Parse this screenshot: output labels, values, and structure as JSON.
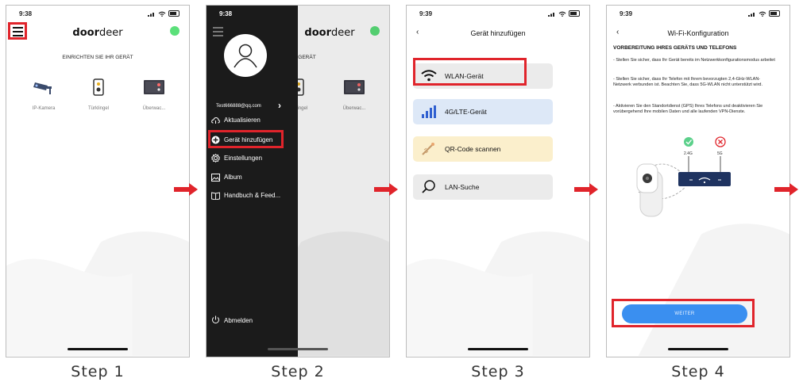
{
  "steps": [
    "Step 1",
    "Step 2",
    "Step 3",
    "Step 4"
  ],
  "colors": {
    "accent_red": "#e0242b",
    "button_blue": "#3a8ff0",
    "status_green": "#5be07a"
  },
  "phone1": {
    "time": "9:38",
    "brand_bold": "door",
    "brand_light": "deer",
    "subtitle": "EINRICHTEN SIE IHR GERÄT",
    "devices": [
      {
        "label": "IP-Kamera",
        "icon": "camera-icon"
      },
      {
        "label": "Türklingel",
        "icon": "doorbell-icon"
      },
      {
        "label": "Überwac...",
        "icon": "monitor-icon"
      }
    ]
  },
  "phone2": {
    "time": "9:38",
    "email": "Test666888@qq.com",
    "menu": [
      "Aktualisieren",
      "Gerät hinzufügen",
      "Einstellungen",
      "Album",
      "Handbuch & Feed..."
    ],
    "logout": "Abmelden",
    "bg_subtitle": "SIE IHR GERÄT",
    "bg_devices": [
      "IP-Kamera",
      "ürklingel",
      "Überwac..."
    ]
  },
  "phone3": {
    "time": "9:39",
    "title": "Gerät hinzufügen",
    "cards": [
      {
        "label": "WLAN-Gerät",
        "icon": "wifi-icon",
        "color": "#ebebeb"
      },
      {
        "label": "4G/LTE-Gerät",
        "icon": "cellular-icon",
        "color": "#dde8f7"
      },
      {
        "label": "QR-Code scannen",
        "icon": "qr-scan-icon",
        "color": "#fbefcc"
      },
      {
        "label": "LAN-Suche",
        "icon": "search-icon",
        "color": "#ebebeb"
      }
    ]
  },
  "phone4": {
    "time": "9:39",
    "title": "Wi-Fi-Konfiguration",
    "heading": "VORBEREITUNG IHRES GERÄTS UND TELEFONS",
    "paragraphs": [
      "- Stellen Sie sicher, dass Ihr Gerät bereits im Netzwerkkonfigurationsmodus arbeitet",
      "- Stellen Sie sicher, dass Ihr Telefon mit Ihrem bevorzugten 2,4-GHz-WLAN-Netzwerk verbunden ist. Beachten Sie, dass 5G-WLAN nicht unterstützt wird.",
      "- Aktivieren Sie den Standortdienst (GPS) Ihres Telefons und deaktivieren Sie vorübergehend Ihre mobilen Daten und alle laufenden VPN-Dienste."
    ],
    "band_ok": "2.4G",
    "band_no": "5G",
    "button": "WEITER"
  }
}
